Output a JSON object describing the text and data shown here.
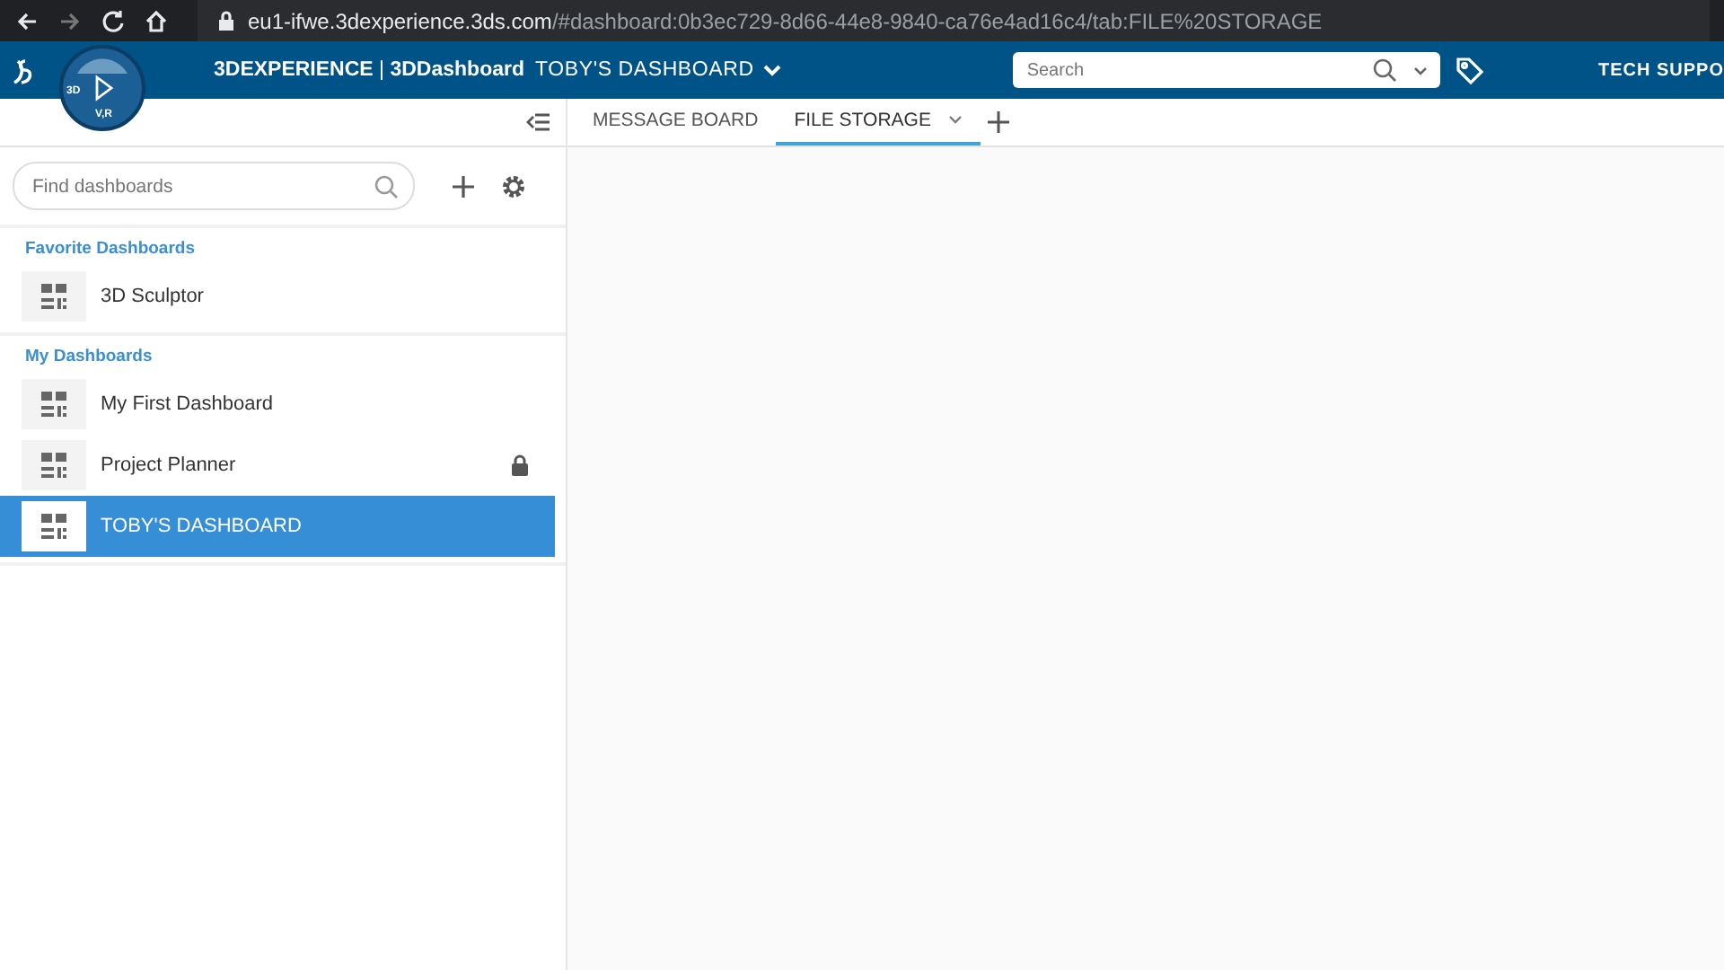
{
  "browser": {
    "url_host": "eu1-ifwe.3dexperience.3ds.com",
    "url_path": "/#dashboard:0b3ec729-8d66-44e8-9840-ca76e4ad16c4/tab:FILE%20STORAGE"
  },
  "header": {
    "compass_labels": [
      "3D",
      "V,R"
    ],
    "brand": "3DEXPERIENCE",
    "separator": "|",
    "app": "3DDashboard",
    "dashboard_title": "TOBY'S DASHBOARD",
    "search": {
      "placeholder": "Search"
    },
    "user": "TECH SUPPO"
  },
  "sidebar": {
    "search": {
      "placeholder": "Find dashboards"
    },
    "sections": [
      {
        "title": "Favorite Dashboards",
        "items": [
          {
            "label": "3D Sculptor",
            "selected": false,
            "locked": false
          }
        ]
      },
      {
        "title": "My Dashboards",
        "items": [
          {
            "label": "My First Dashboard",
            "selected": false,
            "locked": false
          },
          {
            "label": "Project Planner",
            "selected": false,
            "locked": true
          },
          {
            "label": "TOBY'S DASHBOARD",
            "selected": true,
            "locked": false
          }
        ]
      }
    ]
  },
  "tabs": [
    {
      "label": "MESSAGE BOARD",
      "selected": false
    },
    {
      "label": "FILE STORAGE",
      "selected": true
    }
  ]
}
